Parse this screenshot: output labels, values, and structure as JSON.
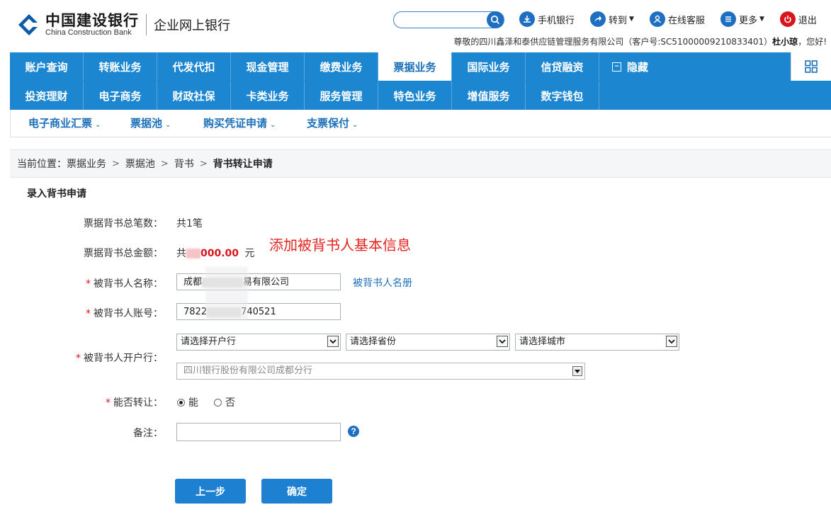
{
  "header": {
    "bank_name_cn": "中国建设银行",
    "bank_name_en": "China Construction Bank",
    "portal_name": "企业网上银行",
    "search_placeholder": "",
    "links": {
      "mobile": "手机银行",
      "goto": "转到",
      "service": "在线客服",
      "more": "更多",
      "logout": "退出"
    },
    "welcome_prefix": "尊敬的四川鑫泽和泰供应链管理服务有限公司（客户号:SC51000009210833401）",
    "welcome_user": "杜小琼",
    "welcome_suffix": "，您好!"
  },
  "nav": {
    "row1": [
      "账户查询",
      "转账业务",
      "代发代扣",
      "现金管理",
      "缴费业务",
      "票据业务",
      "国际业务",
      "信贷融资"
    ],
    "row2": [
      "投资理财",
      "电子商务",
      "财政社保",
      "卡类业务",
      "服务管理",
      "特色业务",
      "增值服务",
      "数字钱包"
    ],
    "active": "票据业务",
    "hide_label": "隐藏"
  },
  "subnav": [
    "电子商业汇票",
    "票据池",
    "购买凭证申请",
    "支票保付"
  ],
  "breadcrumb": {
    "prefix": "当前位置：",
    "items": [
      "票据业务",
      "票据池",
      "背书"
    ],
    "current": "背书转让申请"
  },
  "form": {
    "section_title": "录入背书申请",
    "annotation": "添加被背书人基本信息",
    "total_count_label": "票据背书总笔数：",
    "total_count_value": "共1笔",
    "total_amount_label": "票据背书总金额：",
    "total_amount_prefix": "共",
    "total_amount_value": "000.00",
    "total_amount_unit": "元",
    "endorsee_name_label": "被背书人名称：",
    "endorsee_name_left": "成都",
    "endorsee_name_right": "易有限公司",
    "endorsee_registry_link": "被背书人名册",
    "endorsee_account_label": "被背书人账号：",
    "endorsee_account_left": "7822",
    "endorsee_account_right": "740521",
    "endorsee_bank_label": "被背书人开户行：",
    "bank_select": "请选择开户行",
    "province_select": "请选择省份",
    "city_select": "请选择城市",
    "branch_select": "四川银行股份有限公司成都分行",
    "transferable_label": "能否转让：",
    "option_yes": "能",
    "option_no": "否",
    "transferable_selected": "能",
    "remark_label": "备注：",
    "remark_value": "",
    "help": "?",
    "prev_button": "上一步",
    "confirm_button": "确定"
  },
  "colors": {
    "brand_blue": "#1c86d1",
    "accent_red": "#d8141d",
    "link_blue": "#1c6fb9"
  }
}
